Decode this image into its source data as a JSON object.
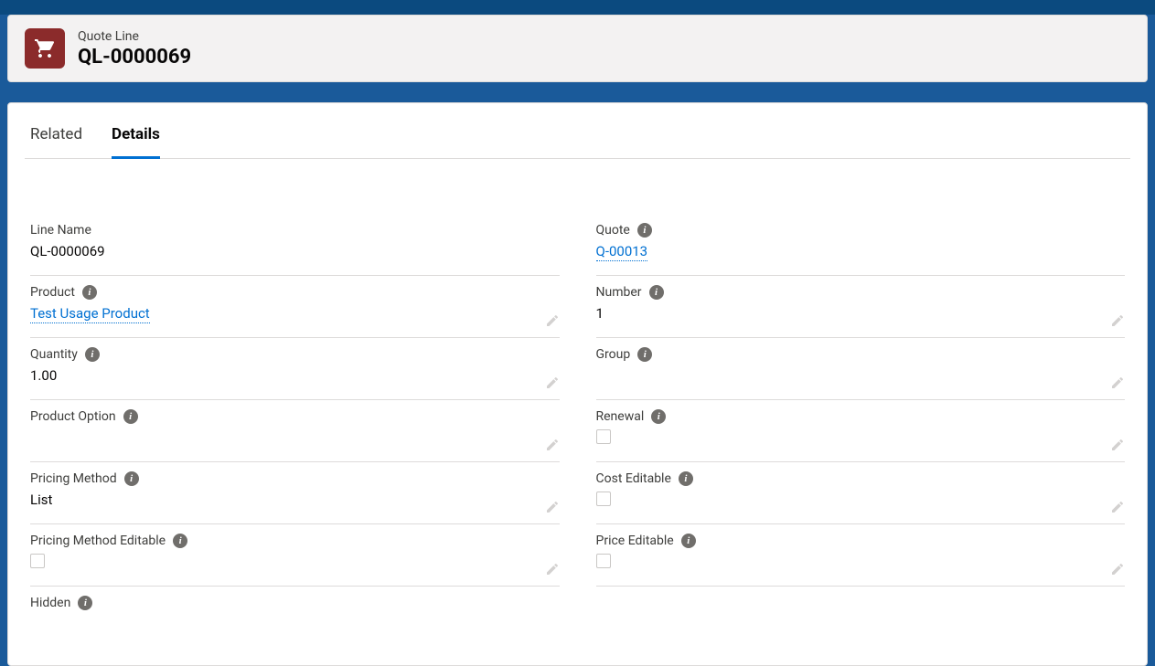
{
  "header": {
    "object_label": "Quote Line",
    "record_title": "QL-0000069"
  },
  "tabs": {
    "related": "Related",
    "details": "Details"
  },
  "fields": {
    "left": [
      {
        "label": "Line Name",
        "value": "QL-0000069",
        "info": false,
        "link": false,
        "editable": false,
        "checkbox": false
      },
      {
        "label": "Product",
        "value": "Test Usage Product",
        "info": true,
        "link": true,
        "editable": true,
        "checkbox": false
      },
      {
        "label": "Quantity",
        "value": "1.00",
        "info": true,
        "link": false,
        "editable": true,
        "checkbox": false
      },
      {
        "label": "Product Option",
        "value": "",
        "info": true,
        "link": false,
        "editable": true,
        "checkbox": false
      },
      {
        "label": "Pricing Method",
        "value": "List",
        "info": true,
        "link": false,
        "editable": true,
        "checkbox": false
      },
      {
        "label": "Pricing Method Editable",
        "value": "",
        "info": true,
        "link": false,
        "editable": true,
        "checkbox": true
      },
      {
        "label": "Hidden",
        "value": "",
        "info": true,
        "link": false,
        "editable": false,
        "checkbox": false,
        "noborder": true
      }
    ],
    "right": [
      {
        "label": "Quote",
        "value": "Q-00013",
        "info": true,
        "link": true,
        "editable": false,
        "checkbox": false
      },
      {
        "label": "Number",
        "value": "1",
        "info": true,
        "link": false,
        "editable": true,
        "checkbox": false
      },
      {
        "label": "Group",
        "value": "",
        "info": true,
        "link": false,
        "editable": true,
        "checkbox": false
      },
      {
        "label": "Renewal",
        "value": "",
        "info": true,
        "link": false,
        "editable": true,
        "checkbox": true
      },
      {
        "label": "Cost Editable",
        "value": "",
        "info": true,
        "link": false,
        "editable": true,
        "checkbox": true
      },
      {
        "label": "Price Editable",
        "value": "",
        "info": true,
        "link": false,
        "editable": true,
        "checkbox": true
      }
    ]
  }
}
